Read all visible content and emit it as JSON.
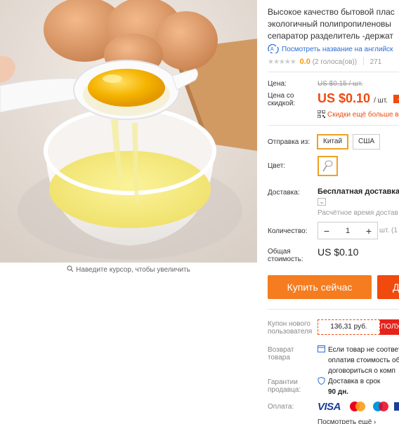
{
  "colors": {
    "accent": "#f04a0f",
    "buy_button": "#f57c1f",
    "link": "#2b6ed6",
    "highlight_border": "#f0a020"
  },
  "product": {
    "title_lines": [
      "Высокое качество бытовой плас",
      "экологичный полипропиленовы",
      "сепаратор разделитель -держат"
    ],
    "translate_link": "Посмотреть название на английск",
    "rating": {
      "stars": "★★★★★",
      "value": "0.0",
      "votes": "(2 голоса(ов))",
      "orders": "271"
    }
  },
  "zoom_hint": "Наведите курсор, чтобы увеличить",
  "price": {
    "label": "Цена:",
    "old": "US $0.15 / шт.",
    "discount_label": "Цена со скидкой:",
    "new": "US $0.10",
    "unit": "/ шт.",
    "discount_badge": "-",
    "more_discount": "Скидки ещё больше в"
  },
  "shipping_from": {
    "label": "Отправка из:",
    "options": [
      "Китай",
      "США"
    ],
    "selected": "Китай"
  },
  "color": {
    "label": "Цвет:"
  },
  "delivery": {
    "label": "Доставка:",
    "text": "Бесплатная доставка в",
    "estimate": "Расчётное время достав"
  },
  "quantity": {
    "label": "Количество:",
    "minus": "−",
    "value": "1",
    "plus": "+",
    "unit": "шт. (1"
  },
  "total": {
    "label": "Общая стоимость:",
    "value": "US $0.10"
  },
  "buttons": {
    "buy_now": "Купить сейчас",
    "add_to_cart": "Д"
  },
  "coupon": {
    "label": "Купон нового пользователя",
    "value": "136,31 руб.",
    "get": "ПОЛУ"
  },
  "returns": {
    "label": "Возврат товара",
    "lines": [
      "Если товар не соответ",
      "оплатив стоимость об",
      "договориться о комп"
    ]
  },
  "guarantee": {
    "label": "Гарантии продавца:",
    "line1": "Доставка в срок",
    "line2": "90 дн."
  },
  "payment": {
    "label": "Оплата:",
    "visa": "VISA",
    "see_all": "Посмотреть ещё"
  }
}
